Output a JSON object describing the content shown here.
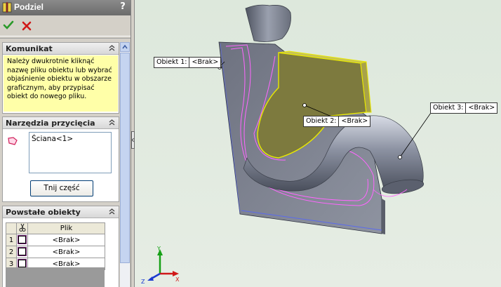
{
  "panel": {
    "title": "Podziel",
    "help": "?",
    "ok_icon": "green-check-icon",
    "cancel_icon": "red-x-icon"
  },
  "komunikat": {
    "title": "Komunikat",
    "message": "Należy dwukrotnie kliknąć nazwę pliku obiektu lub wybrać objaśnienie obiektu w obszarze graficznym, aby przypisać obiekt do nowego pliku."
  },
  "narzedzia": {
    "title": "Narzędzia przycięcia",
    "list_items": [
      "Ściana<1>"
    ],
    "cut_button": "Tnij część"
  },
  "powstale": {
    "title": "Powstałe obiekty",
    "col_plik": "Plik",
    "rows": [
      {
        "num": "1",
        "plik": "<Brak>"
      },
      {
        "num": "2",
        "plik": "<Brak>"
      },
      {
        "num": "3",
        "plik": "<Brak>"
      }
    ]
  },
  "callouts": [
    {
      "label": "Obiekt  1:",
      "value": "<Brak>"
    },
    {
      "label": "Obiekt  2:",
      "value": "<Brak>"
    },
    {
      "label": "Obiekt  3:",
      "value": "<Brak>"
    }
  ],
  "triad": {
    "x": "X",
    "y": "Y",
    "z": "Z"
  },
  "colors": {
    "accent_yellow_face": "#7d7a3e",
    "split_edge_magenta": "#ff66ff",
    "selection_yellow": "#ffff00",
    "model_grey": "#7b7f8c"
  }
}
